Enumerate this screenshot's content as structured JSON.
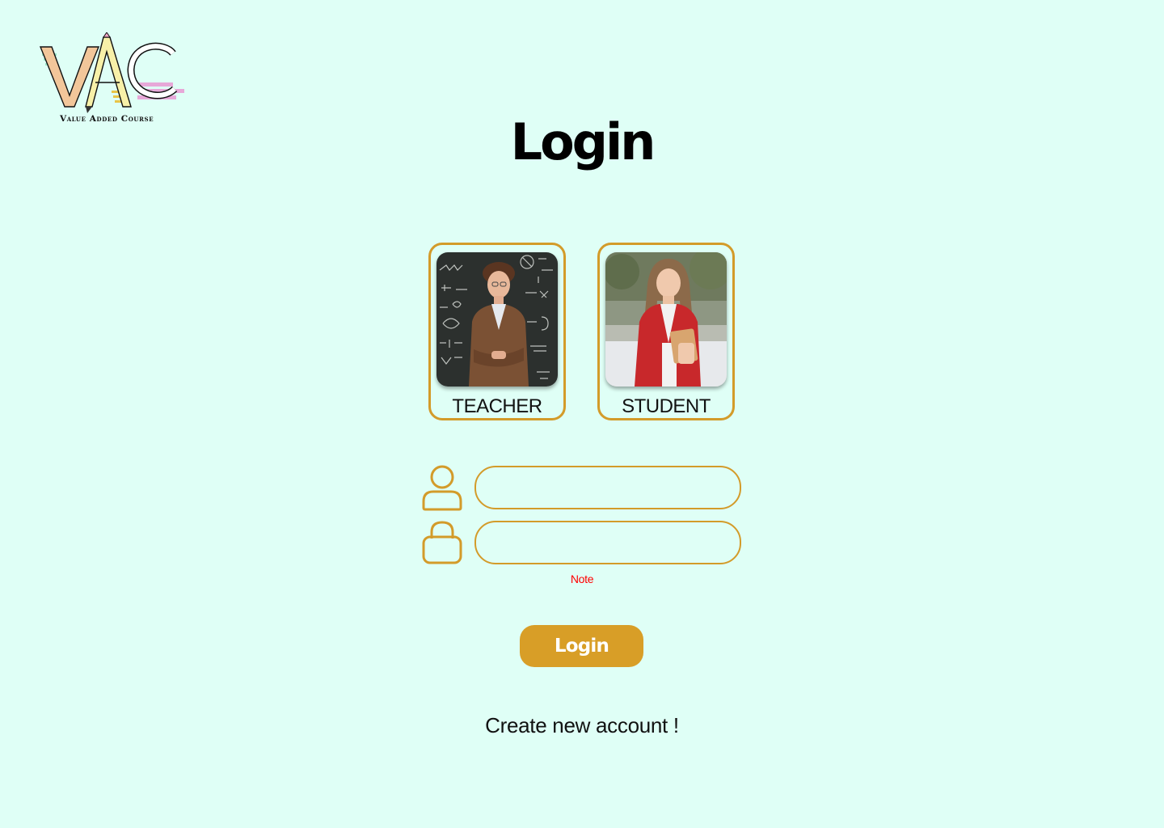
{
  "brand": {
    "logo_letters": "VAC",
    "tagline": "Value Added Course"
  },
  "page": {
    "title": "Login"
  },
  "roles": [
    {
      "id": "teacher",
      "label": "TEACHER"
    },
    {
      "id": "student",
      "label": "STUDENT"
    }
  ],
  "form": {
    "username": {
      "value": "",
      "icon": "user-icon"
    },
    "password": {
      "value": "",
      "icon": "lock-icon"
    },
    "note": "Note",
    "submit_label": "Login"
  },
  "links": {
    "create_account": "Create new account !"
  },
  "colors": {
    "background": "#dffff6",
    "accent": "#d39b2a",
    "button": "#d89e27",
    "note": "#ff0000"
  }
}
